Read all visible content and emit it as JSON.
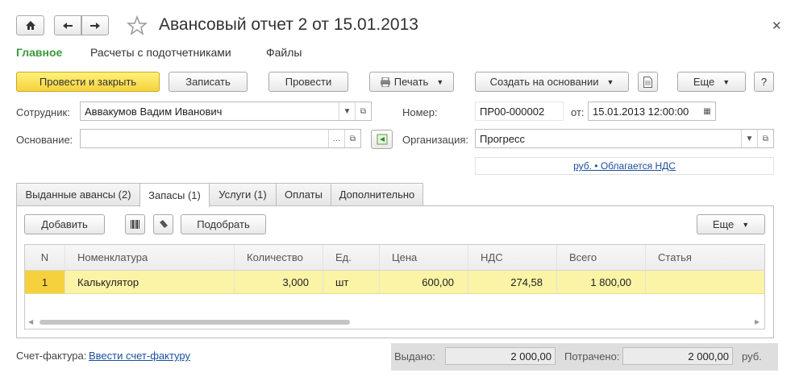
{
  "title": "Авансовый отчет 2 от 15.01.2013",
  "sections": {
    "main": "Главное",
    "settlements": "Расчеты с подотчетниками",
    "files": "Файлы"
  },
  "toolbar": {
    "post_close": "Провести и закрыть",
    "save": "Записать",
    "post": "Провести",
    "print": "Печать",
    "create_based": "Создать на основании",
    "more": "Еще",
    "help": "?"
  },
  "form": {
    "employee_label": "Сотрудник:",
    "employee_value": "Аввакумов Вадим Иванович",
    "number_label": "Номер:",
    "number_value": "ПР00-000002",
    "date_label": "от:",
    "date_value": "15.01.2013 12:00:00",
    "basis_label": "Основание:",
    "basis_value": "",
    "org_label": "Организация:",
    "org_value": "Прогресс",
    "currency_link": "руб. • Облагается НДС"
  },
  "tabs": [
    {
      "label": "Выданные авансы (2)"
    },
    {
      "label": "Запасы (1)"
    },
    {
      "label": "Услуги (1)"
    },
    {
      "label": "Оплаты"
    },
    {
      "label": "Дополнительно"
    }
  ],
  "table_toolbar": {
    "add": "Добавить",
    "select": "Подобрать",
    "more": "Еще"
  },
  "table": {
    "columns": [
      "N",
      "Номенклатура",
      "Количество",
      "Ед.",
      "Цена",
      "НДС",
      "Всего",
      "Статья"
    ],
    "rows": [
      [
        "1",
        "Калькулятор",
        "3,000",
        "шт",
        "600,00",
        "274,58",
        "1 800,00",
        ""
      ]
    ]
  },
  "footer": {
    "invoice_label": "Счет-фактура:",
    "invoice_link": "Ввести счет-фактуру",
    "issued_label": "Выдано:",
    "issued_value": "2 000,00",
    "spent_label": "Потрачено:",
    "spent_value": "2 000,00",
    "currency": "руб."
  },
  "colors": {
    "accent_green": "#3a9a3a",
    "primary_yellow": "#f5d23d",
    "row_highlight": "#fbf3a6"
  }
}
